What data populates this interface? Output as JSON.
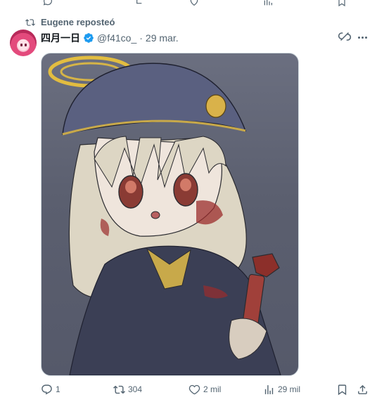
{
  "repost": {
    "label": "Eugene reposteó",
    "icon": "repost-icon"
  },
  "tweet": {
    "display_name": "四月一日",
    "handle": "@f41co_",
    "separator": "·",
    "date": "29 mar.",
    "verified": true,
    "media_alt": "Anime-style illustration of a blonde girl in a grey police cap and dark uniform holding a bloodied pipe wrench",
    "actions": {
      "replies": "1",
      "reposts": "304",
      "likes": "2 mil",
      "views": "29 mil"
    }
  },
  "colors": {
    "accent": "#1d9bf0",
    "muted": "#536471",
    "text": "#0f1419"
  }
}
